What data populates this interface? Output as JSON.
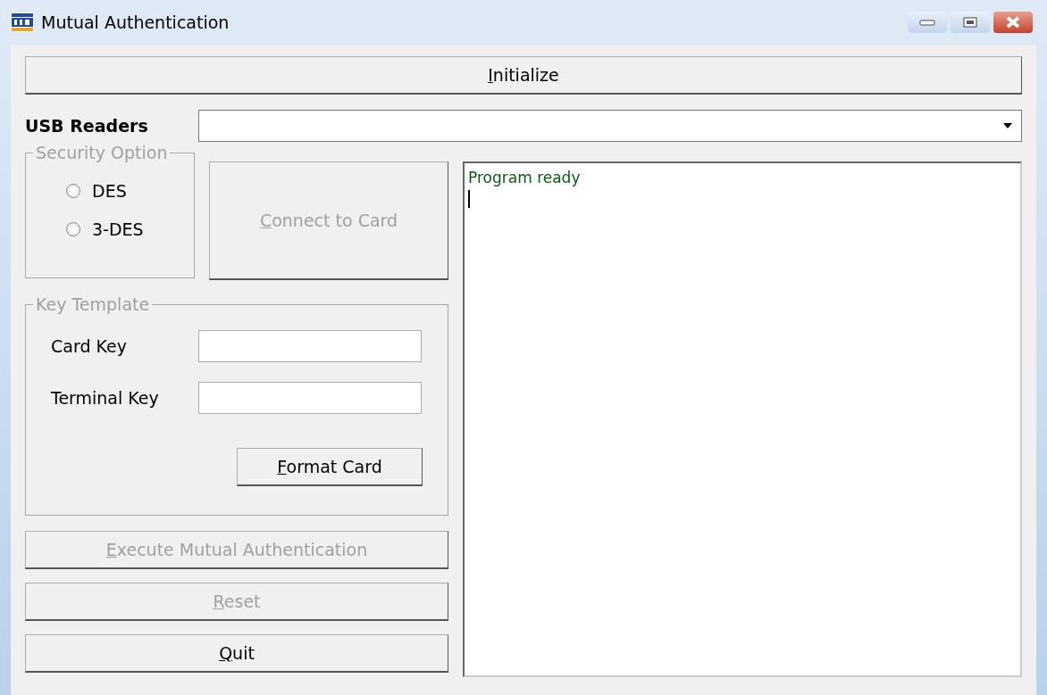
{
  "window": {
    "title": "Mutual Authentication"
  },
  "initialize_button": {
    "label": "Initialize",
    "disabled": false
  },
  "usb_readers": {
    "label": "USB Readers"
  },
  "security_option": {
    "legend": "Security Option",
    "disabled": true,
    "options": [
      {
        "label": "DES",
        "selected": false
      },
      {
        "label": "3-DES",
        "selected": false
      }
    ]
  },
  "connect_button": {
    "label": "Connect to Card",
    "disabled": true
  },
  "key_template": {
    "legend": "Key Template",
    "disabled": true,
    "fields": [
      {
        "label": "Card Key"
      },
      {
        "label": "Terminal Key"
      }
    ],
    "format_button": {
      "label": "Format Card",
      "disabled": false
    }
  },
  "buttons": [
    {
      "label": "Execute Mutual Authentication",
      "disabled": true
    },
    {
      "label": "Reset",
      "disabled": true
    },
    {
      "label": "Quit",
      "disabled": false
    }
  ],
  "log": {
    "lines": [
      "Program ready"
    ]
  }
}
